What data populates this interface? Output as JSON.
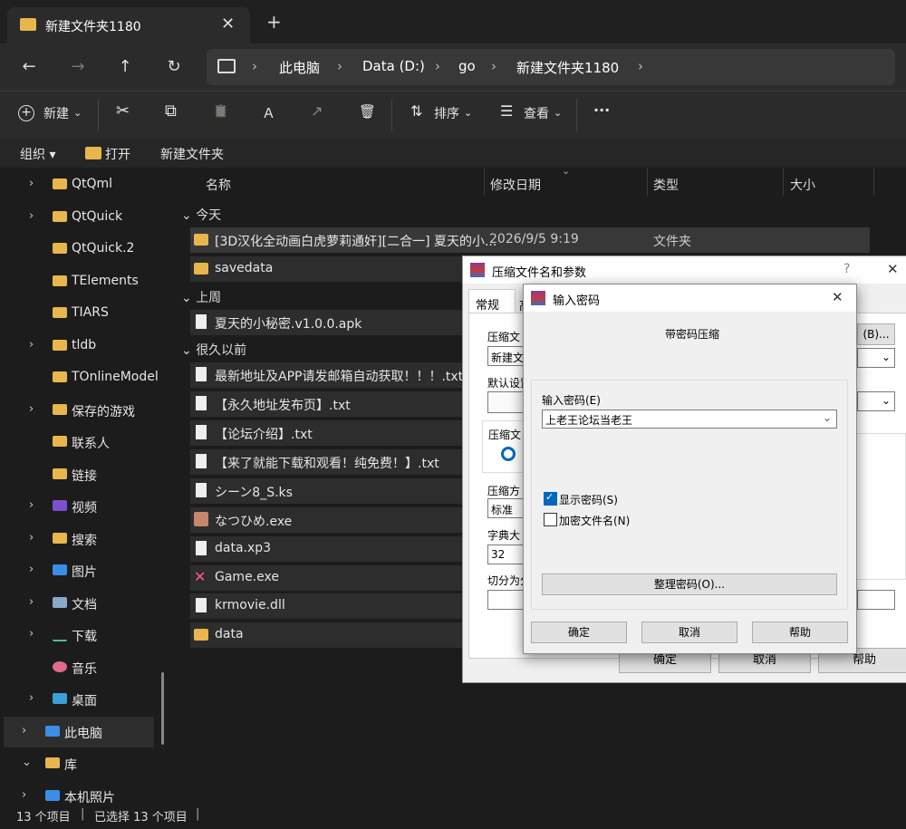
{
  "window": {
    "tab_title": "新建文件夹1180",
    "close_glyph": "✕",
    "newtab_glyph": "+"
  },
  "nav": {
    "back_glyph": "←",
    "forward_glyph": "→",
    "up_glyph": "↑",
    "refresh_glyph": "↻",
    "breadcrumb": [
      "此电脑",
      "Data (D:)",
      "go",
      "新建文件夹1180"
    ],
    "sep_glyph": "›"
  },
  "toolbar": {
    "new_label": "新建",
    "sort_label": "排序",
    "view_label": "查看",
    "more_glyph": "···",
    "cut_glyph": "✂",
    "copy_glyph": "⧉",
    "paste_glyph": "📋",
    "rename_glyph": "Ａ",
    "share_glyph": "↗",
    "delete_glyph": "🗑"
  },
  "ribbon": {
    "organize": "组织 ▾",
    "open": "打开",
    "new_folder": "新建文件夹"
  },
  "sidebar": {
    "items": [
      {
        "label": "QtQml",
        "expand": "›"
      },
      {
        "label": "QtQuick",
        "expand": "›"
      },
      {
        "label": "QtQuick.2",
        "expand": ""
      },
      {
        "label": "TElements",
        "expand": ""
      },
      {
        "label": "TIARS",
        "expand": ""
      },
      {
        "label": "tldb",
        "expand": "›"
      },
      {
        "label": "TOnlineModel",
        "expand": ""
      },
      {
        "label": "保存的游戏",
        "expand": "›"
      },
      {
        "label": "联系人",
        "expand": ""
      },
      {
        "label": "链接",
        "expand": ""
      },
      {
        "label": "视频",
        "expand": "›"
      },
      {
        "label": "搜索",
        "expand": "›"
      },
      {
        "label": "图片",
        "expand": "›"
      },
      {
        "label": "文档",
        "expand": "›"
      },
      {
        "label": "下载",
        "expand": "›"
      },
      {
        "label": "音乐",
        "expand": ""
      },
      {
        "label": "桌面",
        "expand": "›"
      },
      {
        "label": "此电脑",
        "expand": "›"
      },
      {
        "label": "库",
        "expand": "⌄"
      },
      {
        "label": "本机照片",
        "expand": "›"
      }
    ]
  },
  "columns": {
    "name": "名称",
    "date": "修改日期",
    "type": "类型",
    "size": "大小"
  },
  "groups": {
    "today": "今天",
    "lastweek": "上周",
    "longago": "很久以前",
    "collapse_glyph": "⌄"
  },
  "files": [
    {
      "name": "[3D汉化全动画白虎萝莉通奸][二合一] 夏天的小...",
      "date": "2026/9/5 9:19",
      "type": "文件夹"
    },
    {
      "name": "savedata",
      "date": "",
      "type": ""
    },
    {
      "name": "夏天的小秘密.v1.0.0.apk",
      "date": "",
      "type": ""
    },
    {
      "name": "最新地址及APP请发邮箱自动获取！！！.txt",
      "date": "",
      "type": ""
    },
    {
      "name": "【永久地址发布页】.txt",
      "date": "",
      "type": ""
    },
    {
      "name": "【论坛介绍】.txt",
      "date": "",
      "type": ""
    },
    {
      "name": "【来了就能下载和观看！纯免费！】.txt",
      "date": "",
      "type": ""
    },
    {
      "name": "シーン8_S.ks",
      "date": "",
      "type": ""
    },
    {
      "name": "なつひめ.exe",
      "date": "",
      "type": ""
    },
    {
      "name": "data.xp3",
      "date": "",
      "type": ""
    },
    {
      "name": "Game.exe",
      "date": "",
      "type": ""
    },
    {
      "name": "krmovie.dll",
      "date": "",
      "type": ""
    },
    {
      "name": "data",
      "date": "",
      "type": ""
    }
  ],
  "status": {
    "count": "13 个项目",
    "selected": "已选择 13 个项目"
  },
  "archive_dialog": {
    "title": "压缩文件名和参数",
    "help_glyph": "?",
    "close_glyph": "✕",
    "tab_general": "常规",
    "tab_adv": "高",
    "archive_name_label": "压缩文",
    "archive_name_value": "新建文",
    "browse_label": "(B)...",
    "default_profile_label": "默认设置",
    "format_label": "压缩文",
    "method_label": "压缩方",
    "method_value": "标准",
    "dict_label": "字典大",
    "dict_value": "32",
    "split_label": "切分为分",
    "ok_label": "确定",
    "cancel_label": "取消",
    "help_label": "帮助"
  },
  "password_dialog": {
    "title": "输入密码",
    "close_glyph": "✕",
    "heading": "带密码压缩",
    "field_label": "输入密码(E)",
    "password_value": "上老王论坛当老王",
    "show_password": "显示密码(S)",
    "encrypt_names": "加密文件名(N)",
    "organize_label": "整理密码(O)...",
    "ok_label": "确定",
    "cancel_label": "取消",
    "help_label": "帮助"
  }
}
